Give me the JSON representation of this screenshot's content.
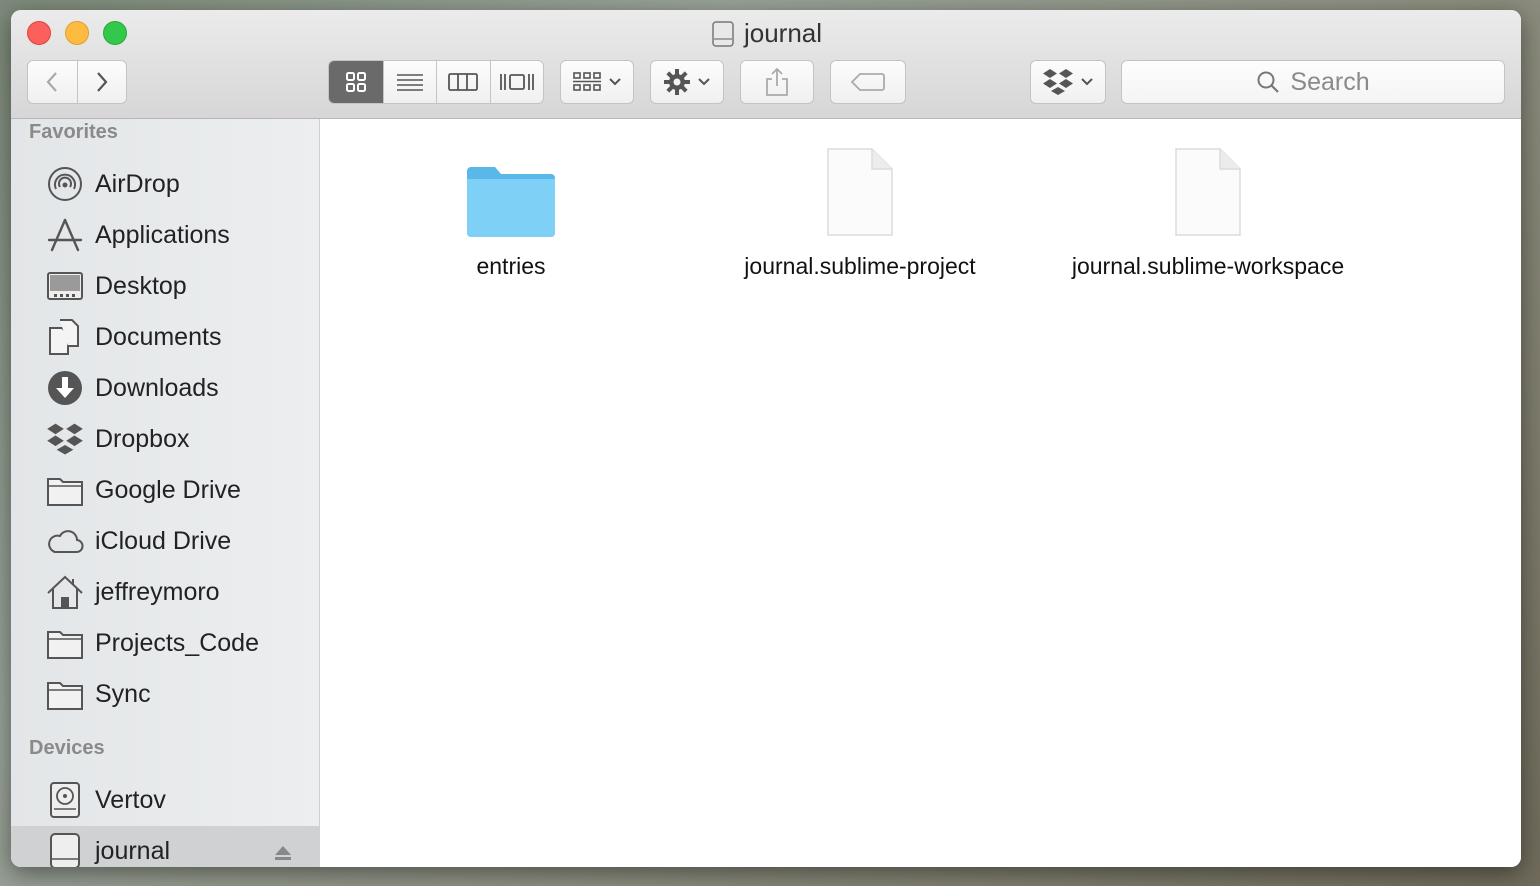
{
  "window": {
    "title": "journal"
  },
  "toolbar": {
    "back_icon": "chevron-left-icon",
    "forward_icon": "chevron-right-icon",
    "views": [
      "icon-view",
      "list-view",
      "column-view",
      "coverflow-view"
    ],
    "active_view": "icon-view",
    "arrange_icon": "arrange-grid-icon",
    "action_icon": "gear-icon",
    "share_icon": "share-icon",
    "tag_icon": "tag-icon",
    "dropbox_icon": "dropbox-icon",
    "search_placeholder": "Search"
  },
  "sidebar": {
    "favorites_header": "Favorites",
    "favorites": [
      {
        "label": "AirDrop",
        "icon": "airdrop-icon"
      },
      {
        "label": "Applications",
        "icon": "applications-icon"
      },
      {
        "label": "Desktop",
        "icon": "desktop-icon"
      },
      {
        "label": "Documents",
        "icon": "documents-icon"
      },
      {
        "label": "Downloads",
        "icon": "downloads-icon"
      },
      {
        "label": "Dropbox",
        "icon": "dropbox-icon"
      },
      {
        "label": "Google Drive",
        "icon": "folder-icon"
      },
      {
        "label": "iCloud Drive",
        "icon": "cloud-icon"
      },
      {
        "label": "jeffreymoro",
        "icon": "home-icon"
      },
      {
        "label": "Projects_Code",
        "icon": "folder-icon"
      },
      {
        "label": "Sync",
        "icon": "folder-icon"
      }
    ],
    "devices_header": "Devices",
    "devices": [
      {
        "label": "Vertov",
        "icon": "hard-drive-icon"
      },
      {
        "label": "journal",
        "icon": "disk-icon",
        "selected": true
      }
    ]
  },
  "files": [
    {
      "name": "entries",
      "kind": "folder"
    },
    {
      "name": "journal.sublime-project",
      "kind": "document"
    },
    {
      "name": "journal.sublime-workspace",
      "kind": "document"
    }
  ],
  "colors": {
    "folder": "#6cc8f4",
    "selected_view": "#6a6a6a",
    "sidebar_selected": "#cfd1d3"
  }
}
